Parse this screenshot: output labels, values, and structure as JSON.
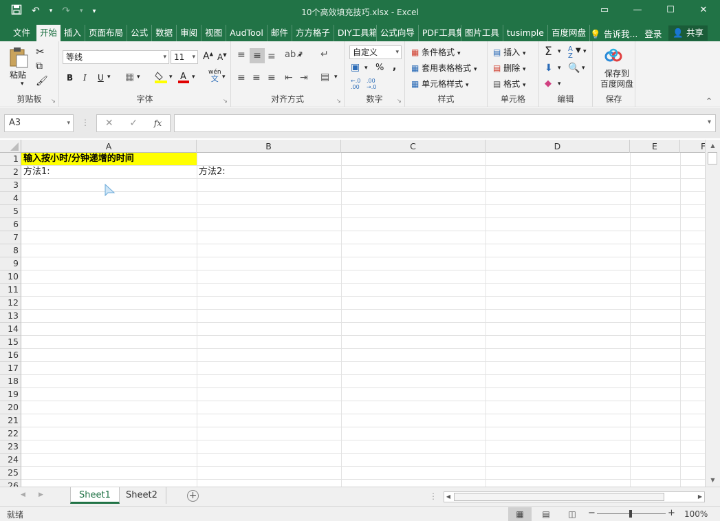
{
  "window": {
    "title": "10个高效填充技巧.xlsx - Excel",
    "qat": {
      "save_icon": "💾",
      "undo_icon": "↶",
      "redo_icon": "↷",
      "customize_icon": "▾"
    },
    "controls": {
      "ribbon_options": "▭",
      "minimize": "—",
      "maximize": "☐",
      "close": "✕"
    }
  },
  "ribbon_tabs": [
    "文件",
    "开始",
    "插入",
    "页面布局",
    "公式",
    "数据",
    "审阅",
    "视图",
    "AudTool",
    "邮件",
    "方方格子",
    "DIY工具箱",
    "公式向导",
    "PDF工具集",
    "图片工具",
    "tusimple",
    "百度网盘"
  ],
  "active_tab": "开始",
  "tellme": "告诉我...",
  "login": "登录",
  "share": "共享",
  "ribbon": {
    "clipboard": {
      "paste": "粘贴",
      "label": "剪贴板"
    },
    "font": {
      "name": "等线",
      "size": "11",
      "bold": "B",
      "italic": "I",
      "underline": "U",
      "grow": "A",
      "shrink": "A",
      "phonetic_top": "wén",
      "phonetic_bottom": "文",
      "label": "字体"
    },
    "alignment": {
      "label": "对齐方式"
    },
    "number": {
      "format": "自定义",
      "percent": "%",
      "comma": ",",
      "inc_decimal": "←.0 .00",
      "dec_decimal": ".00 →.0",
      "label": "数字"
    },
    "styles": {
      "conditional": "条件格式",
      "table": "套用表格格式",
      "cell": "单元格样式",
      "label": "样式"
    },
    "cells": {
      "insert": "插入",
      "delete": "删除",
      "format": "格式",
      "label": "单元格"
    },
    "editing": {
      "label": "编辑"
    },
    "save": {
      "line1": "保存到",
      "line2": "百度网盘",
      "label": "保存"
    }
  },
  "formula_bar": {
    "name_box": "A3",
    "cancel": "✕",
    "enter": "✓",
    "fx": "fx",
    "value": ""
  },
  "columns": [
    "A",
    "B",
    "C",
    "D",
    "E",
    "F"
  ],
  "rows": [
    "1",
    "2",
    "3",
    "4",
    "5",
    "6",
    "7",
    "8",
    "9",
    "10",
    "11",
    "12",
    "13",
    "14",
    "15",
    "16",
    "17",
    "18",
    "19",
    "20",
    "21",
    "22",
    "23",
    "24",
    "25",
    "26"
  ],
  "cells": {
    "A1": "输入按小时/分钟递增的时间",
    "A2": "方法1:",
    "B2": "方法2:"
  },
  "sheets": [
    "Sheet1",
    "Sheet2"
  ],
  "active_sheet": "Sheet1",
  "status": {
    "ready": "就绪",
    "zoom": "100%",
    "zoom_value": 1.0
  },
  "colors": {
    "accent": "#217346",
    "highlight": "#ffff00"
  }
}
